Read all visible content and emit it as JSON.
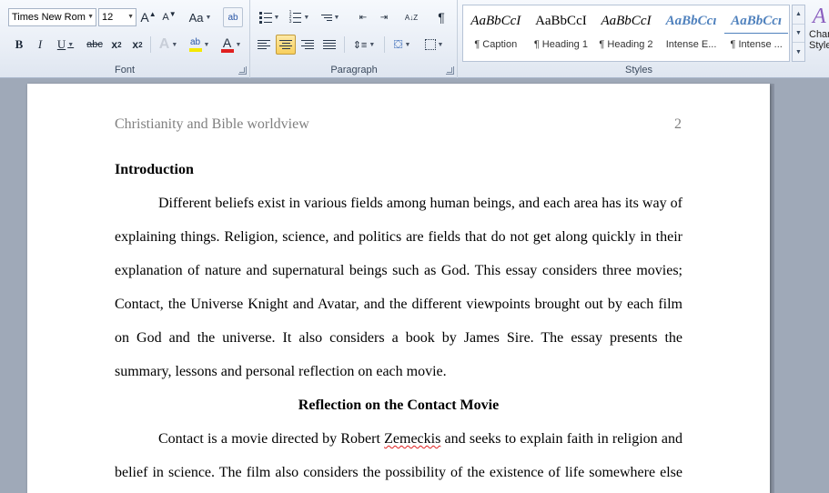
{
  "font_group": {
    "label": "Font",
    "font_name": "Times New Rom",
    "font_size": "12",
    "grow_label": "A",
    "shrink_label": "A",
    "case_label": "Aa",
    "clear_format_label": "ab",
    "bold_label": "B",
    "italic_label": "I",
    "underline_label": "U",
    "strike_label": "abc",
    "subscript_label": "x",
    "subscript_small": "2",
    "superscript_label": "x",
    "superscript_small": "2",
    "text_effect_label": "A",
    "highlight_label": "ab",
    "font_color_label": "A",
    "highlight_color": "#f5e800",
    "font_color": "#e02020"
  },
  "paragraph_group": {
    "label": "Paragraph",
    "sort_label": "A↓Z",
    "pilcrow_label": "¶"
  },
  "styles_group": {
    "label": "Styles",
    "items": [
      {
        "sample": "AaBbCcI",
        "name": "¶ Caption",
        "color": "#000000",
        "italic": true
      },
      {
        "sample": "AaBbCcI",
        "name": "¶ Heading 1",
        "color": "#000000",
        "italic": false
      },
      {
        "sample": "AaBbCcI",
        "name": "¶ Heading 2",
        "color": "#000000",
        "italic": true
      },
      {
        "sample": "AaBbCcı",
        "name": "Intense E...",
        "color": "#4f81bd",
        "italic": true
      },
      {
        "sample": "AaBbCcı",
        "name": "¶ Intense ...",
        "color": "#4f81bd",
        "italic": true
      }
    ],
    "change_styles_big": "A",
    "change_styles_label": "Change Styles"
  },
  "document": {
    "header_text": "Christianity and Bible worldview",
    "page_number": "2",
    "heading_intro": "Introduction",
    "intro_lines": [
      "Different beliefs exist in various fields among human beings, and each area has its way of",
      "explaining things. Religion, science, and politics are fields that do not get along quickly in their",
      "explanation of nature and supernatural beings such as God. This essay considers three movies;",
      "Contact, the Universe Knight and Avatar, and the different viewpoints brought out by each film",
      "on God and the universe. It also considers a book by James Sire. The essay presents the",
      "summary, lessons and personal reflection on each movie."
    ],
    "heading_contact": "Reflection on the Contact Movie",
    "contact_line1_pre": "Contact is a movie directed by Robert ",
    "contact_line1_misspelled": "Zemeckis",
    "contact_line1_post": " and seeks to explain faith in religion and",
    "contact_line2": "belief in science. The film also considers the possibility of the existence of life somewhere else"
  }
}
